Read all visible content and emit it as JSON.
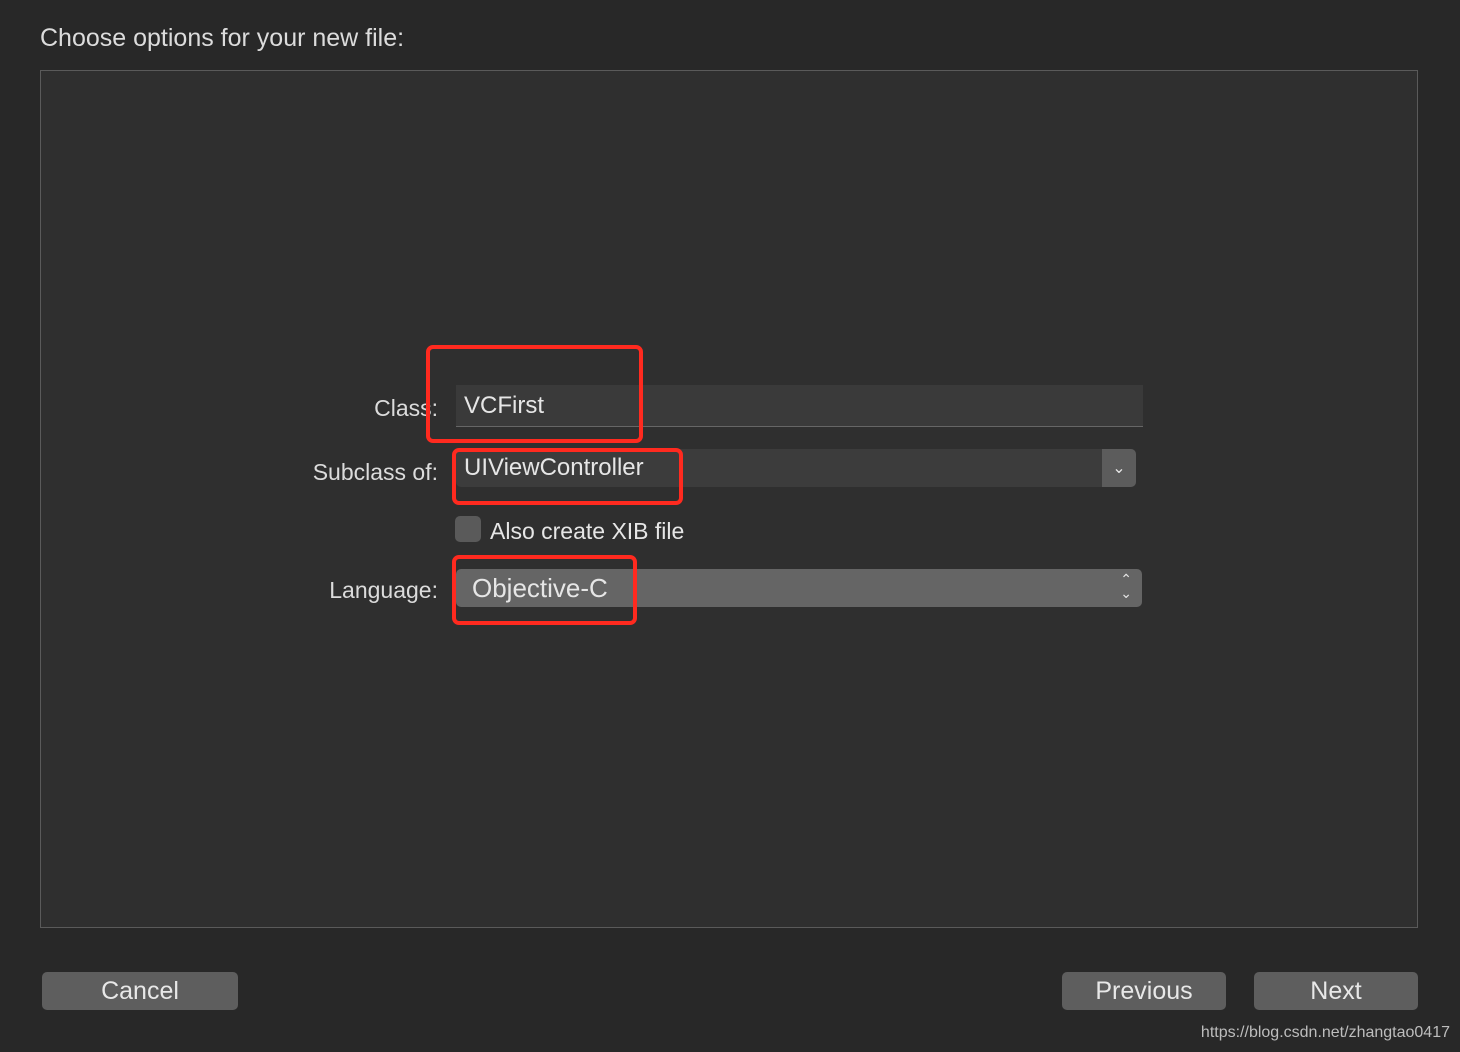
{
  "title": "Choose options for your new file:",
  "form": {
    "class_label": "Class:",
    "class_value": "VCFirst",
    "subclass_label": "Subclass of:",
    "subclass_value": "UIViewController",
    "xib_label": "Also create XIB file",
    "xib_checked": false,
    "language_label": "Language:",
    "language_value": "Objective-C"
  },
  "buttons": {
    "cancel": "Cancel",
    "previous": "Previous",
    "next": "Next"
  },
  "watermark": "https://blog.csdn.net/zhangtao0417",
  "colors": {
    "highlight": "#ff2a1f"
  }
}
